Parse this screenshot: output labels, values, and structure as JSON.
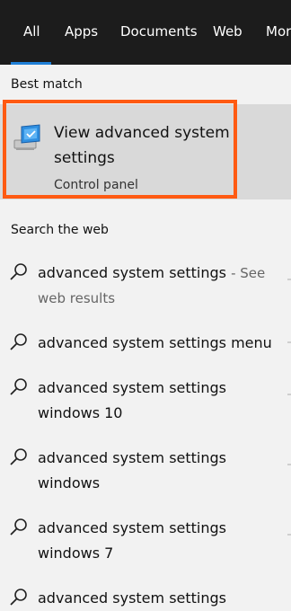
{
  "tabs": [
    {
      "label": "All"
    },
    {
      "label": "Apps"
    },
    {
      "label": "Documents"
    },
    {
      "label": "Web"
    },
    {
      "label": "More"
    }
  ],
  "best_match": {
    "heading": "Best match",
    "title": "View advanced system settings",
    "subtitle": "Control panel",
    "icon": "system-settings-icon"
  },
  "web": {
    "heading": "Search the web",
    "results": [
      {
        "query": "advanced system settings",
        "suffix": "- See",
        "suffix2": "web results"
      },
      {
        "query": "advanced system settings",
        "suffix_bold": "menu"
      },
      {
        "query": "advanced system settings",
        "suffix_bold": "windows 10"
      },
      {
        "query": "advanced system settings",
        "suffix_bold": "windows"
      },
      {
        "query": "advanced system settings",
        "suffix_bold": "windows 7"
      },
      {
        "query": "advanced system settings"
      }
    ]
  },
  "colors": {
    "tab_bar": "#1c1c1c",
    "accent": "#1f7fd6",
    "highlight": "#ff5a12",
    "card": "#d9d9d9"
  }
}
